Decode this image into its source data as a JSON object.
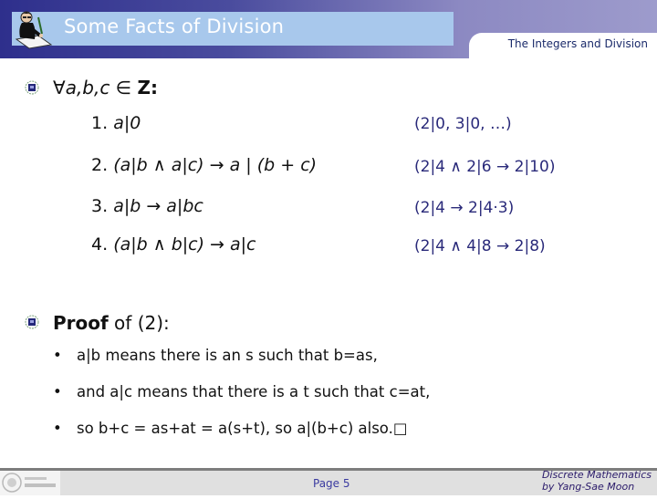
{
  "header": {
    "title": "Some Facts of Division",
    "subtitle": "The Integers and Division",
    "title_icon": "person-writing-icon"
  },
  "main": {
    "statement": {
      "bullet_icon": "slide-bullet-icon",
      "quantifier": "∀",
      "vars": "a,b,c",
      "member": " ∈ ",
      "set": "Z:"
    },
    "facts": [
      {
        "number": "1.",
        "text": "a|0",
        "example": "(2|0, 3|0, …)"
      },
      {
        "number": "2.",
        "text": "(a|b ∧ a|c) → a | (b + c)",
        "example": "(2|4 ∧ 2|6 → 2|10)"
      },
      {
        "number": "3.",
        "text": "a|b → a|bc",
        "example": "(2|4 → 2|4·3)"
      },
      {
        "number": "4.",
        "text": "(a|b ∧ b|c) → a|c",
        "example": "(2|4 ∧ 4|8 → 2|8)"
      }
    ],
    "proof": {
      "bullet_icon": "slide-bullet-icon",
      "heading_bold": "Proof",
      "heading_rest": " of (2):",
      "lines": [
        "a|b means there is an s such that b=as,",
        "and a|c means that there is a t such that c=at,",
        "so b+c = as+at = a(s+t), so a|(b+c) also.□"
      ],
      "bullet": "•"
    }
  },
  "footer": {
    "logo": "university-logo",
    "page": "Page 5",
    "credit_line1": "Discrete Mathematics",
    "credit_line2": "by Yang-Sae Moon"
  }
}
